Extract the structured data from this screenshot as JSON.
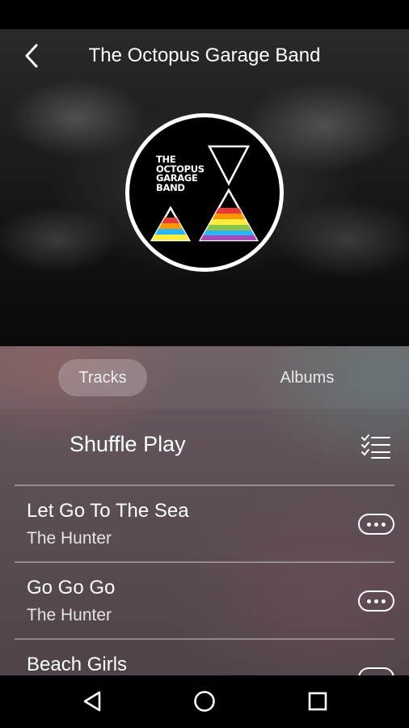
{
  "header": {
    "title": "The Octopus Garage Band",
    "back_icon": "chevron-left-icon"
  },
  "album_art": {
    "band_text_lines": [
      "THE",
      "OCTOPUS",
      "GARAGE",
      "BAND"
    ],
    "stripe_colors": [
      "#e53935",
      "#ff9800",
      "#ffeb3b",
      "#8bc34a",
      "#29b6f6",
      "#ab47bc"
    ]
  },
  "tabs": [
    {
      "label": "Tracks",
      "selected": true
    },
    {
      "label": "Albums",
      "selected": false
    }
  ],
  "shuffle": {
    "label": "Shuffle Play",
    "queue_icon": "checklist-icon"
  },
  "tracks": [
    {
      "title": "Let Go To The Sea",
      "artist": "The Hunter",
      "more_icon": "more-icon"
    },
    {
      "title": "Go Go Go",
      "artist": "The Hunter",
      "more_icon": "more-icon"
    },
    {
      "title": "Beach Girls",
      "artist": "",
      "more_icon": "more-icon"
    }
  ],
  "nav_bar": {
    "back_icon": "triangle-back-icon",
    "home_icon": "circle-home-icon",
    "recents_icon": "square-recents-icon"
  }
}
